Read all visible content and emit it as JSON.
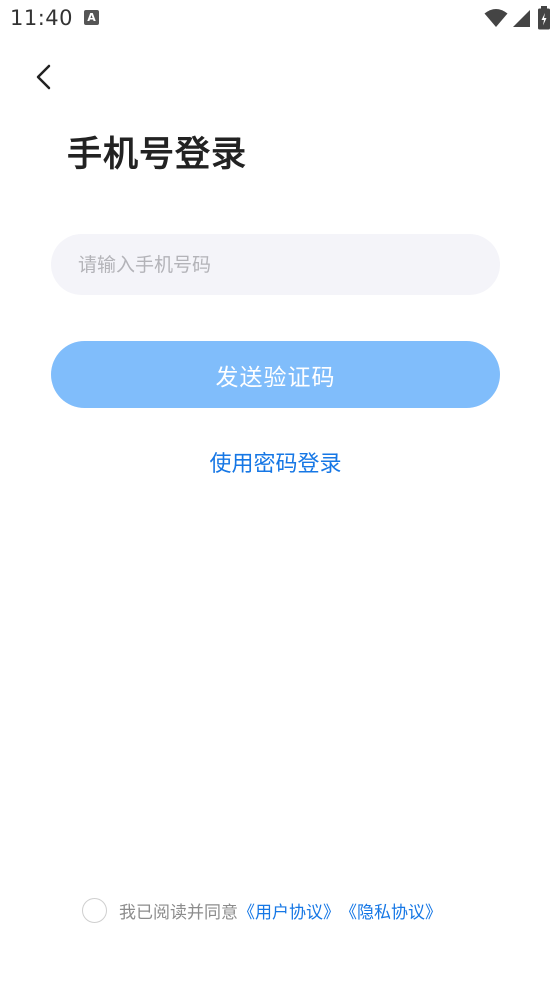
{
  "status_bar": {
    "time": "11:40",
    "notification_icon_letter": "A",
    "icons": [
      "wifi-icon",
      "signal-icon",
      "battery-icon"
    ]
  },
  "nav": {
    "back_icon": "chevron-left-icon"
  },
  "title": "手机号登录",
  "phone_input": {
    "placeholder": "请输入手机号码",
    "value": ""
  },
  "send_code_button": {
    "label": "发送验证码",
    "color": "#80bdfb"
  },
  "password_login_link": "使用密码登录",
  "agreement": {
    "checked": false,
    "prefix": "我已阅读并同意",
    "user_agreement": "《用户协议》",
    "privacy_policy": "《隐私协议》"
  },
  "colors": {
    "accent": "#1677e5",
    "input_background": "#f4f4f9",
    "title": "#222222"
  }
}
